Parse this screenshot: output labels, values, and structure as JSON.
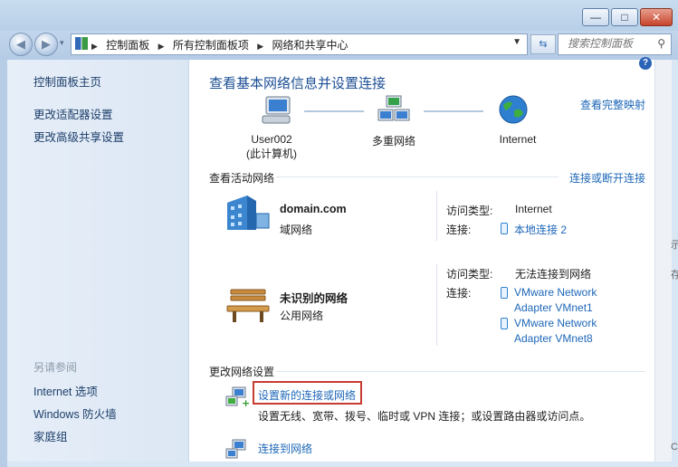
{
  "window": {
    "minimize_glyph": "—",
    "maximize_glyph": "□",
    "close_glyph": "✕"
  },
  "address": {
    "crumbs": [
      "控制面板",
      "所有控制面板项",
      "网络和共享中心"
    ],
    "search_placeholder": "搜索控制面板"
  },
  "sidebar": {
    "top_links": [
      "控制面板主页",
      "更改适配器设置",
      "更改高级共享设置"
    ],
    "see_also_heading": "另请参阅",
    "see_also_links": [
      "Internet 选项",
      "Windows 防火墙",
      "家庭组"
    ]
  },
  "main": {
    "title": "查看基本网络信息并设置连接",
    "view_full_map": "查看完整映射",
    "nodes": [
      {
        "line1": "User002",
        "line2": "(此计算机)"
      },
      {
        "line1": "多重网络",
        "line2": ""
      },
      {
        "line1": "Internet",
        "line2": ""
      }
    ],
    "active_heading": "查看活动网络",
    "connect_disconnect": "连接或断开连接",
    "networks": [
      {
        "name": "domain.com",
        "type": "域网络",
        "access_label": "访问类型:",
        "access_value": "Internet",
        "conn_label": "连接:",
        "connections": [
          "本地连接 2"
        ]
      },
      {
        "name": "未识别的网络",
        "type": "公用网络",
        "access_label": "访问类型:",
        "access_value": "无法连接到网络",
        "conn_label": "连接:",
        "connections": [
          "VMware Network Adapter VMnet1",
          "VMware Network Adapter VMnet8"
        ]
      }
    ],
    "change_heading": "更改网络设置",
    "tasks": [
      {
        "label": "设置新的连接或网络",
        "desc": "设置无线、宽带、拨号、临时或 VPN 连接；或设置路由器或访问点。"
      },
      {
        "label": "连接到网络",
        "desc": ""
      }
    ]
  },
  "overflow": {
    "text1": "示",
    "text2": "存储",
    "text3": "C"
  },
  "colors": {
    "link": "#1d67b8",
    "title": "#1b4e94",
    "highlight_box": "#c63b32"
  }
}
